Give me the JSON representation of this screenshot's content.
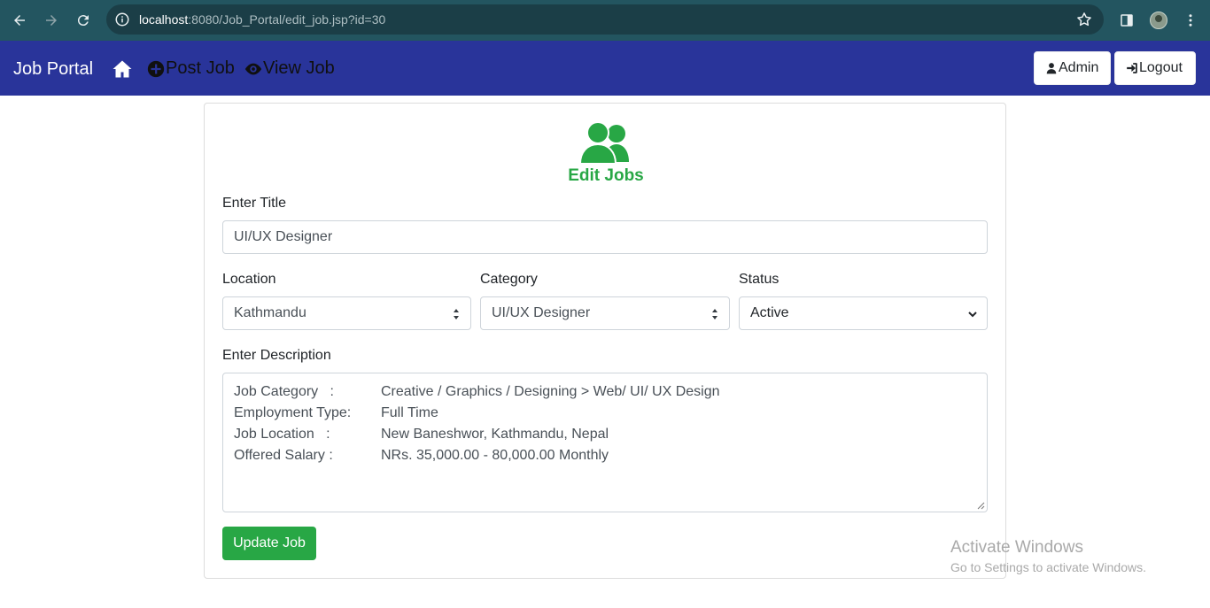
{
  "browser": {
    "url_host": "localhost",
    "url_rest": ":8080/Job_Portal/edit_job.jsp?id=30",
    "icons": [
      "back-arrow-icon",
      "forward-arrow-icon",
      "reload-icon",
      "site-info-icon",
      "bookmark-star-icon",
      "sidebar-icon",
      "profile-avatar",
      "kebab-menu-icon"
    ]
  },
  "navbar": {
    "brand": "Job Portal",
    "post_job": "Post Job",
    "view_job": "View Job",
    "admin": "Admin",
    "logout": "Logout",
    "bg_color": "#29349a"
  },
  "form": {
    "heading": "Edit Jobs",
    "title_label": "Enter Title",
    "title_value": "UI/UX Designer",
    "location_label": "Location",
    "location_value": "Kathmandu",
    "category_label": "Category",
    "category_value": "UI/UX Designer",
    "status_label": "Status",
    "status_value": "Active",
    "description_label": "Enter Description",
    "description_lines": [
      {
        "key": "Job Category   :",
        "value": "Creative / Graphics / Designing > Web/ UI/ UX Design"
      },
      {
        "key": "Employment Type:",
        "value": "Full Time"
      },
      {
        "key": "Job Location   :",
        "value": "New Baneshwor, Kathmandu, Nepal"
      },
      {
        "key": "Offered Salary :",
        "value": "NRs. 35,000.00 - 80,000.00 Monthly"
      }
    ],
    "submit_label": "Update Job",
    "accent_color": "#28a745"
  },
  "watermark": {
    "line1": "Activate Windows",
    "line2": "Go to Settings to activate Windows."
  }
}
